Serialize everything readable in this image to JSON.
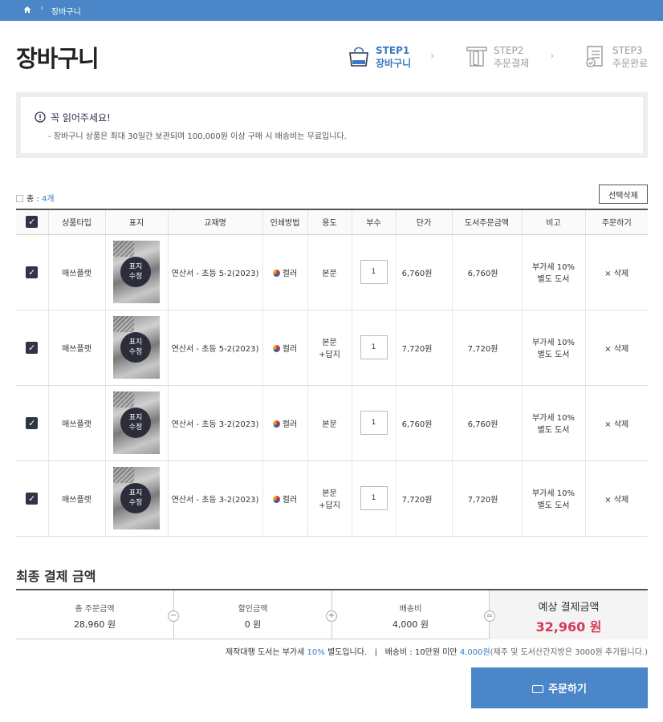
{
  "breadcrumb": {
    "current": "장바구니"
  },
  "page_title": "장바구니",
  "steps": [
    {
      "num": "STEP1",
      "name": "장바구니",
      "active": true,
      "icon": "shopping-bag-icon"
    },
    {
      "num": "STEP2",
      "name": "주문결제",
      "active": false,
      "icon": "door-icon"
    },
    {
      "num": "STEP3",
      "name": "주문완료",
      "active": false,
      "icon": "document-check-icon"
    }
  ],
  "notice": {
    "title": "꼭 읽어주세요!",
    "text": "- 장바구니 상품은 최대 30일간 보관되며 100,000원 이상 구매 시 배송비는 무료입니다."
  },
  "total": {
    "label": "총 :",
    "count": "4개"
  },
  "delete_selected": "선택삭제",
  "table": {
    "headers": [
      "상품타입",
      "표지",
      "교재명",
      "인쇄방법",
      "용도",
      "부수",
      "단가",
      "도서주문금액",
      "비고",
      "주문하기"
    ],
    "cover_badge": [
      "표지",
      "수정"
    ],
    "rows": [
      {
        "type": "매쓰플랫",
        "title": "연산서 - 초등 5-2(2023)",
        "print": "컬러",
        "usage": [
          "본문"
        ],
        "qty": "1",
        "unit_price": "6,760원",
        "amount": "6,760원",
        "note": [
          "부가세 10%",
          "별도 도서"
        ],
        "delete": "× 삭제"
      },
      {
        "type": "매쓰플랫",
        "title": "연산서 - 초등 5-2(2023)",
        "print": "컬러",
        "usage": [
          "본문",
          "+답지"
        ],
        "qty": "1",
        "unit_price": "7,720원",
        "amount": "7,720원",
        "note": [
          "부가세 10%",
          "별도 도서"
        ],
        "delete": "× 삭제"
      },
      {
        "type": "매쓰플랫",
        "title": "연산서 - 초등 3-2(2023)",
        "print": "컬러",
        "usage": [
          "본문"
        ],
        "qty": "1",
        "unit_price": "6,760원",
        "amount": "6,760원",
        "note": [
          "부가세 10%",
          "별도 도서"
        ],
        "delete": "× 삭제"
      },
      {
        "type": "매쓰플랫",
        "title": "연산서 - 초등 3-2(2023)",
        "print": "컬러",
        "usage": [
          "본문",
          "+답지"
        ],
        "qty": "1",
        "unit_price": "7,720원",
        "amount": "7,720원",
        "note": [
          "부가세 10%",
          "별도 도서"
        ],
        "delete": "× 삭제"
      }
    ]
  },
  "summary": {
    "title": "최종 결제 금액",
    "items": [
      {
        "label": "총 주문금액",
        "value": "28,960 원"
      },
      {
        "label": "할인금액",
        "value": "0 원"
      },
      {
        "label": "배송비",
        "value": "4,000 원"
      },
      {
        "label": "예상 결제금액",
        "value": "32,960 원"
      }
    ],
    "operators": [
      "−",
      "+",
      "="
    ]
  },
  "footnote": {
    "part1": "제작대행 도서는 부가세 ",
    "part1_hl": "10%",
    "part1_end": " 별도입니다.",
    "divider": "|",
    "part2": "배송비 : 10만원 미만 ",
    "part2_hl": "4,000원",
    "part2_small": "(제주 및 도서산간지방은 3000원 추가됩니다.)"
  },
  "order_button": "주문하기",
  "colors": {
    "accent": "#4a86c8",
    "step_active": "#3a78c2",
    "final_price": "#d63a5a"
  }
}
